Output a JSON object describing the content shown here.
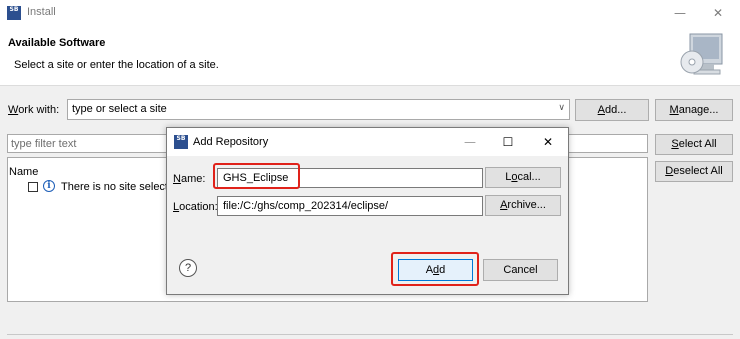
{
  "window": {
    "title": "Install",
    "icon_text": "SB"
  },
  "header": {
    "title": "Available Software",
    "subtitle": "Select a site or enter the location of a site."
  },
  "work_with": {
    "label_underlined": "W",
    "label_rest": "ork with:",
    "value": "type or select a site",
    "add_u": "A",
    "add_rest": "dd...",
    "manage_u": "M",
    "manage_rest": "anage..."
  },
  "filter": {
    "placeholder": "type filter text"
  },
  "buttons": {
    "select_all_u": "S",
    "select_all_rest": "elect All",
    "deselect_all_u": "D",
    "deselect_all_rest": "eselect All"
  },
  "list": {
    "header": "Name",
    "row_text": "There is no site select"
  },
  "dialog": {
    "title": "Add Repository",
    "icon_text": "SB",
    "name_label_u": "N",
    "name_label_rest": "ame:",
    "name_value": "GHS_Eclipse",
    "location_label_u": "L",
    "location_label_rest": "ocation:",
    "location_value": "file:/C:/ghs/comp_202314/eclipse/",
    "local_pre": "L",
    "local_u": "o",
    "local_rest": "cal...",
    "archive_u": "A",
    "archive_rest": "rchive...",
    "add_pre": "A",
    "add_u": "d",
    "add_rest": "d",
    "cancel": "Cancel",
    "help_glyph": "?"
  },
  "colors": {
    "highlight": "#e0221a",
    "selected_button_border": "#0078d7"
  }
}
